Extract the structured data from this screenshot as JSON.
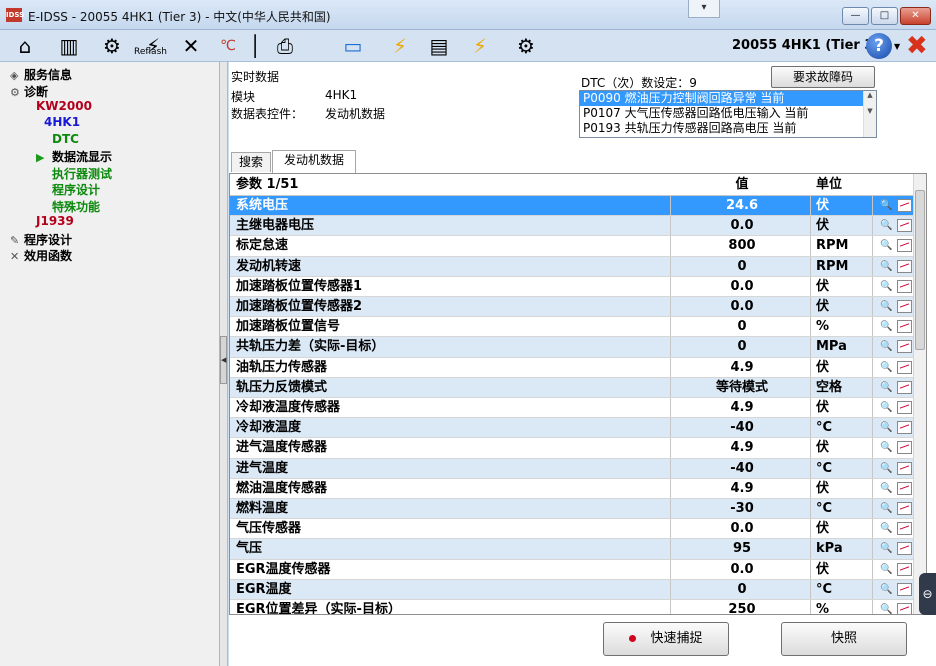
{
  "window": {
    "app_icon_text": "IDSS",
    "title": "E-IDSS - 20055 4HK1 (Tier 3)  - 中文(中华人民共和国)",
    "title_dropdown": "▾",
    "minimize": "—",
    "maximize": "□",
    "close": "✕"
  },
  "toolbar": {
    "tools": [
      {
        "name": "home-icon",
        "glyph": "⌂"
      },
      {
        "name": "book-icon",
        "glyph": "▥"
      },
      {
        "name": "engine-icon",
        "glyph": "⚙"
      },
      {
        "name": "reflash-icon",
        "glyph": "⚡",
        "label": "Reflash"
      },
      {
        "name": "tools-icon",
        "glyph": "✕"
      },
      {
        "name": "temperature-icon",
        "glyph": "℃"
      },
      {
        "name": "pin-icon",
        "glyph": "│"
      },
      {
        "name": "printer-icon",
        "glyph": "⎙"
      },
      {
        "name": "laptop-icon",
        "glyph": "▭"
      },
      {
        "name": "bolt-icon",
        "glyph": "⚡"
      },
      {
        "name": "device-icon",
        "glyph": "▤"
      },
      {
        "name": "bolt-icon-2",
        "glyph": "⚡"
      },
      {
        "name": "engine-icon-2",
        "glyph": "⚙"
      }
    ],
    "vehicle": "20055 4HK1 (Tier 3)",
    "help": "?",
    "exit": "✖"
  },
  "sidebar": {
    "items": [
      {
        "label": "服务信息",
        "color": "#000000"
      },
      {
        "label": "诊断",
        "color": "#000000"
      },
      {
        "label": "KW2000",
        "color": "#b3001b"
      },
      {
        "label": "4HK1",
        "color": "#1a1ad6"
      },
      {
        "label": "DTC",
        "color": "#0d8a0d"
      },
      {
        "label": "数据流显示",
        "color": "#000000"
      },
      {
        "label": "执行器测试",
        "color": "#0d8a0d"
      },
      {
        "label": "程序设计",
        "color": "#0d8a0d"
      },
      {
        "label": "特殊功能",
        "color": "#0d8a0d"
      },
      {
        "label": "J1939",
        "color": "#b3001b"
      },
      {
        "label": "程序设计",
        "color": "#000000"
      },
      {
        "label": "效用函数",
        "color": "#000000"
      }
    ]
  },
  "info": {
    "heading": "实时数据",
    "module_label": "模块",
    "module_value": "4HK1",
    "table_label": "数据表控件：",
    "table_value": "发动机数据",
    "dtc_count_label": "DTC（次）数设定：9",
    "fault_button": "要求故障码"
  },
  "dtc_list": [
    "P0090 燃油压力控制阀回路异常 当前",
    "P0107 大气压传感器回路低电压输入 当前",
    "P0193 共轨压力传感器回路高电压 当前"
  ],
  "tabs": [
    "搜索",
    "发动机数据"
  ],
  "grid": {
    "headers": {
      "name": "参数 1/51",
      "value": "值",
      "unit": "单位"
    },
    "rows": [
      {
        "name": "系统电压",
        "value": "24.6",
        "unit": "伏"
      },
      {
        "name": "主继电器电压",
        "value": "0.0",
        "unit": "伏"
      },
      {
        "name": "标定怠速",
        "value": "800",
        "unit": "RPM"
      },
      {
        "name": "发动机转速",
        "value": "0",
        "unit": "RPM"
      },
      {
        "name": "加速踏板位置传感器1",
        "value": "0.0",
        "unit": "伏"
      },
      {
        "name": "加速踏板位置传感器2",
        "value": "0.0",
        "unit": "伏"
      },
      {
        "name": "加速踏板位置信号",
        "value": "0",
        "unit": "%"
      },
      {
        "name": "共轨压力差（实际-目标）",
        "value": "0",
        "unit": "MPa"
      },
      {
        "name": "油轨压力传感器",
        "value": "4.9",
        "unit": "伏"
      },
      {
        "name": "轨压力反馈模式",
        "value": "等待模式",
        "unit": "空格"
      },
      {
        "name": "冷却液温度传感器",
        "value": "4.9",
        "unit": "伏"
      },
      {
        "name": "冷却液温度",
        "value": "-40",
        "unit": "°C"
      },
      {
        "name": "进气温度传感器",
        "value": "4.9",
        "unit": "伏"
      },
      {
        "name": "进气温度",
        "value": "-40",
        "unit": "°C"
      },
      {
        "name": "燃油温度传感器",
        "value": "4.9",
        "unit": "伏"
      },
      {
        "name": "燃料温度",
        "value": "-30",
        "unit": "°C"
      },
      {
        "name": "气压传感器",
        "value": "0.0",
        "unit": "伏"
      },
      {
        "name": "气压",
        "value": "95",
        "unit": "kPa"
      },
      {
        "name": "EGR温度传感器",
        "value": "0.0",
        "unit": "伏"
      },
      {
        "name": "EGR温度",
        "value": "0",
        "unit": "°C"
      },
      {
        "name": "EGR位置差异（实际-目标）",
        "value": "250",
        "unit": "%"
      }
    ]
  },
  "buttons": {
    "capture": "快速捕捉",
    "snapshot": "快照"
  }
}
